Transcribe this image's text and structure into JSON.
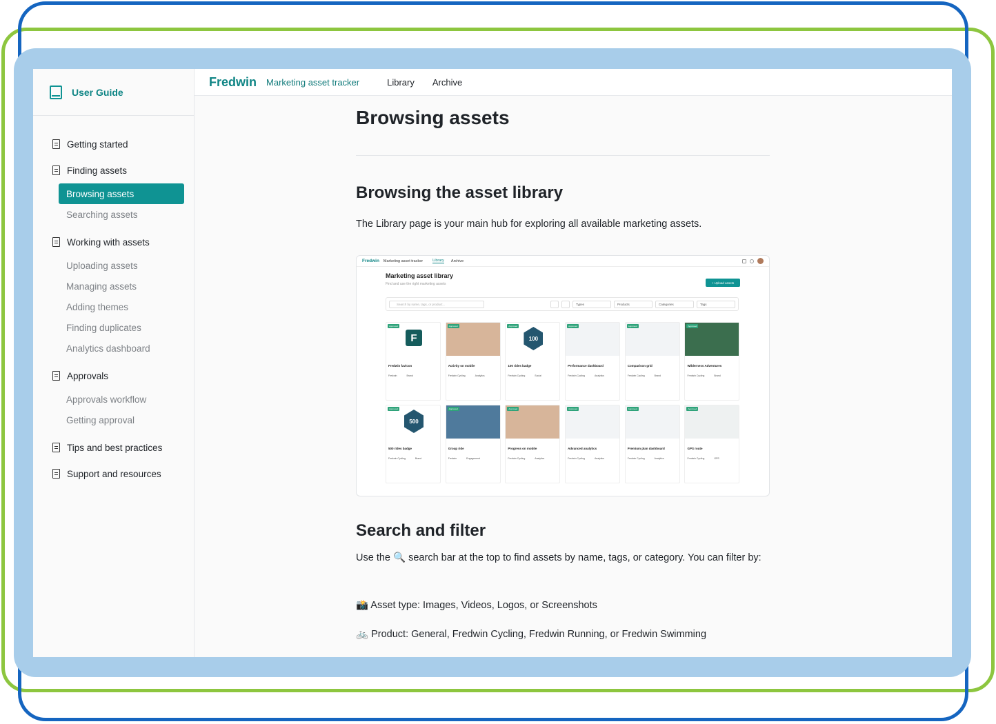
{
  "sidebar": {
    "title": "User Guide",
    "groups": [
      {
        "label": "Getting started",
        "items": []
      },
      {
        "label": "Finding assets",
        "items": [
          {
            "label": "Browsing assets",
            "active": true
          },
          {
            "label": "Searching assets",
            "active": false
          }
        ]
      },
      {
        "label": "Working with assets",
        "items": [
          {
            "label": "Uploading assets"
          },
          {
            "label": "Managing assets"
          },
          {
            "label": "Adding themes"
          },
          {
            "label": "Finding duplicates"
          },
          {
            "label": "Analytics dashboard"
          }
        ]
      },
      {
        "label": "Approvals",
        "items": [
          {
            "label": "Approvals workflow"
          },
          {
            "label": "Getting approval"
          }
        ]
      },
      {
        "label": "Tips and best practices",
        "items": []
      },
      {
        "label": "Support and resources",
        "items": []
      }
    ]
  },
  "topbar": {
    "brand": "Fredwin",
    "subtitle": "Marketing asset tracker",
    "links": [
      "Library",
      "Archive"
    ]
  },
  "content": {
    "title": "Browsing assets",
    "section1_title": "Browsing the asset library",
    "section1_text": "The Library page is your main hub for exploring all available marketing assets.",
    "section2_title": "Search and filter",
    "section2_text_before": "Use the",
    "section2_text_after": "search bar at the top to find assets by name, tags, or category. You can filter by:",
    "filter1": "Asset type: Images, Videos, Logos, or Screenshots",
    "filter2": "Product: General, Fredwin Cycling, Fredwin Running, or Fredwin Swimming"
  },
  "embedded_screenshot": {
    "brand": "Fredwin",
    "subtitle": "Marketing asset tracker",
    "links": [
      "Library",
      "Archive"
    ],
    "title": "Marketing asset library",
    "description": "Find and use the right marketing assets",
    "upload_label": "+ Upload assets",
    "search_placeholder": "Search by name, tags, or product...",
    "filters": [
      "Types",
      "Products",
      "Categories",
      "Tags"
    ],
    "badge": "Approved",
    "cards": [
      {
        "name": "Fredwin favicon",
        "product": "Fredwin",
        "category": "Brand",
        "thumb": "logo"
      },
      {
        "name": "Activity on mobile",
        "product": "Fredwin Cycling",
        "category": "Analytics",
        "thumb": "photo"
      },
      {
        "name": "100 rides badge",
        "product": "Fredwin Cycling",
        "category": "Social",
        "thumb": "hex100"
      },
      {
        "name": "Performance dashboard",
        "product": "Fredwin Cycling",
        "category": "Analytics",
        "thumb": "dash"
      },
      {
        "name": "Comparison grid",
        "product": "Fredwin Cycling",
        "category": "Brand",
        "thumb": "dash"
      },
      {
        "name": "Wilderness Adventures",
        "product": "Fredwin Cycling",
        "category": "Brand",
        "thumb": "wild"
      },
      {
        "name": "500 rides badge",
        "product": "Fredwin Cycling",
        "category": "Brand",
        "thumb": "hex500"
      },
      {
        "name": "Group ride",
        "product": "Fredwin",
        "category": "Engagement",
        "thumb": "group"
      },
      {
        "name": "Progress on mobile",
        "product": "Fredwin Cycling",
        "category": "Analytics",
        "thumb": "photo"
      },
      {
        "name": "Advanced analytics",
        "product": "Fredwin Cycling",
        "category": "Analytics",
        "thumb": "dash"
      },
      {
        "name": "Premium plan dashboard",
        "product": "Fredwin Cycling",
        "category": "Analytics",
        "thumb": "dash"
      },
      {
        "name": "GPS route",
        "product": "Fredwin Cycling",
        "category": "GPS",
        "thumb": "map"
      }
    ]
  },
  "colors": {
    "accent": "#0f9393",
    "frame_blue": "#1565c0",
    "frame_green": "#8dc63f",
    "frame_fill": "#a8cdea"
  }
}
